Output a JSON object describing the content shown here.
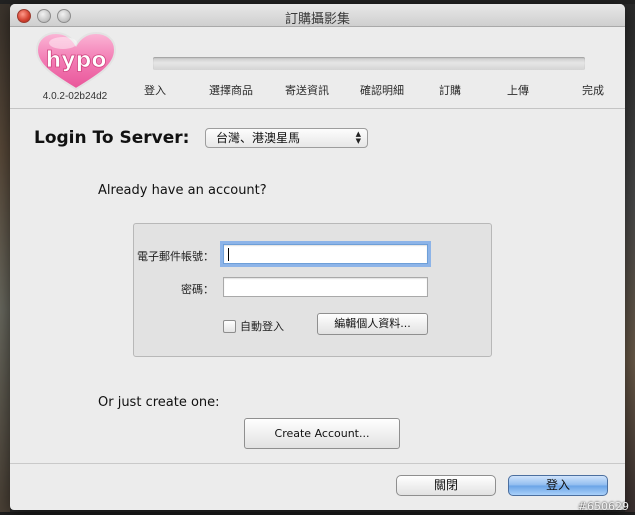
{
  "window": {
    "title": "訂購攝影集"
  },
  "header": {
    "logo_text": "hypo",
    "version": "4.0.2-02b24d2",
    "steps": [
      "登入",
      "選擇商品",
      "寄送資訊",
      "確認明細",
      "訂購",
      "上傳",
      "完成"
    ]
  },
  "login": {
    "title": "Login To Server:",
    "server_selected": "台灣、港澳星馬",
    "already_text": "Already have an account?",
    "email_label": "電子郵件帳號：",
    "email_value": "",
    "password_label": "密碼：",
    "password_value": "",
    "auto_login_label": "自動登入",
    "auto_login_checked": false,
    "edit_profile_button": "編輯個人資料..."
  },
  "create": {
    "text": "Or just create one:",
    "button": "Create Account..."
  },
  "footer": {
    "close_button": "關閉",
    "login_button": "登入"
  },
  "watermark": "#650629",
  "colors": {
    "login_button_blue": "#6aa3e6",
    "logo_pink": "#f06aa8",
    "focus_ring": "#8db4e8"
  }
}
